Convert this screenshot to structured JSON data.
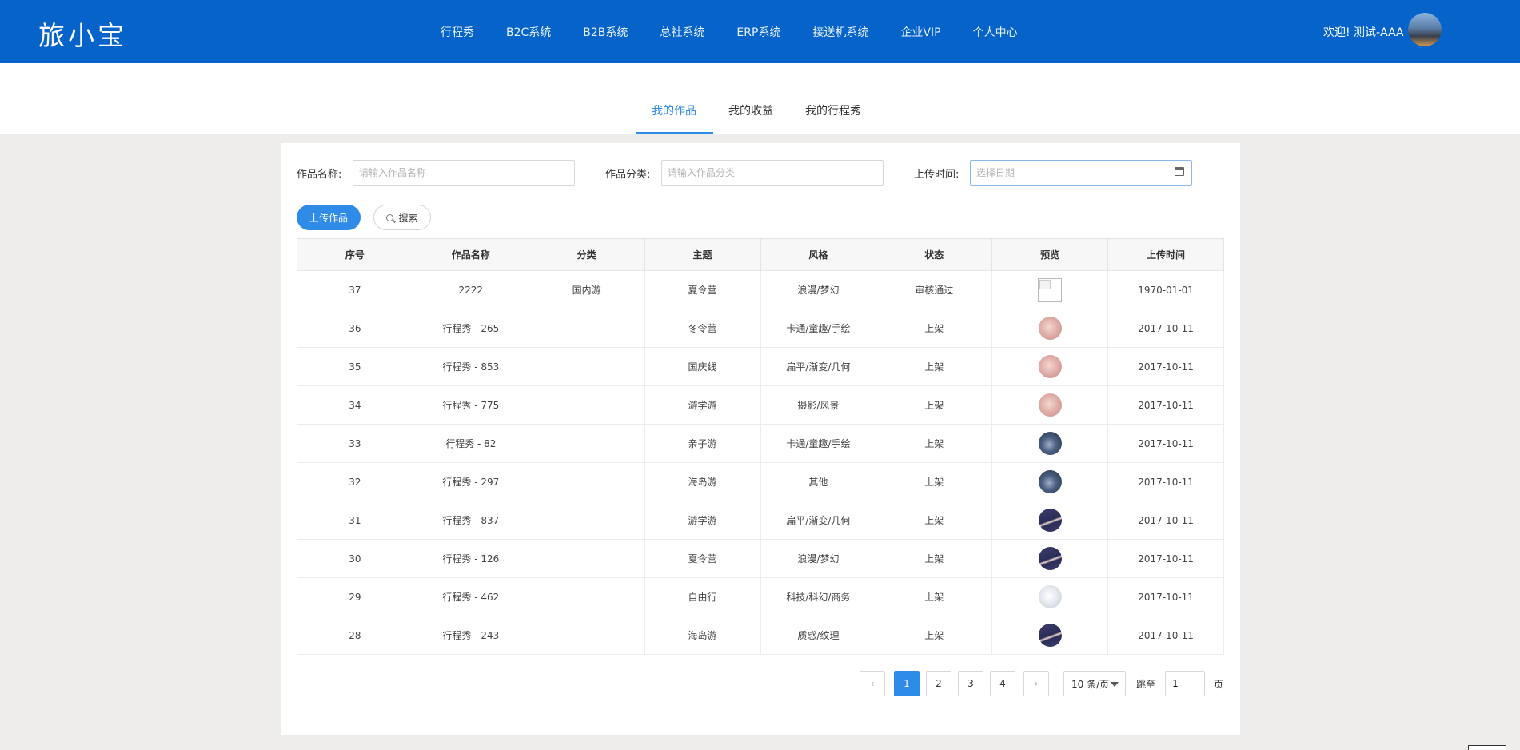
{
  "header": {
    "logo": "旅小宝",
    "nav": [
      "行程秀",
      "B2C系统",
      "B2B系统",
      "总社系统",
      "ERP系统",
      "接送机系统",
      "企业VIP",
      "个人中心"
    ],
    "welcome": "欢迎! 测试-AAA",
    "brand_color": "#0563c9"
  },
  "tabs": {
    "items": [
      "我的作品",
      "我的收益",
      "我的行程秀"
    ],
    "active": "我的作品"
  },
  "filters": {
    "name_label": "作品名称:",
    "name_placeholder": "请输入作品名称",
    "category_label": "作品分类:",
    "category_placeholder": "请输入作品分类",
    "time_label": "上传时间:",
    "time_placeholder": "选择日期",
    "upload_button": "上传作品",
    "search_button": "搜索"
  },
  "table": {
    "columns": [
      "序号",
      "作品名称",
      "分类",
      "主题",
      "风格",
      "状态",
      "预览",
      "上传时间"
    ],
    "rows": [
      {
        "id": "37",
        "name": "2222",
        "category": "国内游",
        "theme": "夏令营",
        "style": "浪漫/梦幻",
        "status": "审核通过",
        "preview": "broken",
        "date": "1970-01-01"
      },
      {
        "id": "36",
        "name": "行程秀 - 265",
        "category": "",
        "theme": "冬令营",
        "style": "卡通/童趣/手绘",
        "status": "上架",
        "preview": "pink",
        "date": "2017-10-11"
      },
      {
        "id": "35",
        "name": "行程秀 - 853",
        "category": "",
        "theme": "国庆线",
        "style": "扁平/渐变/几何",
        "status": "上架",
        "preview": "pink",
        "date": "2017-10-11"
      },
      {
        "id": "34",
        "name": "行程秀 - 775",
        "category": "",
        "theme": "游学游",
        "style": "摄影/风景",
        "status": "上架",
        "preview": "pink",
        "date": "2017-10-11"
      },
      {
        "id": "33",
        "name": "行程秀 - 82",
        "category": "",
        "theme": "亲子游",
        "style": "卡通/童趣/手绘",
        "status": "上架",
        "preview": "navy",
        "date": "2017-10-11"
      },
      {
        "id": "32",
        "name": "行程秀 - 297",
        "category": "",
        "theme": "海岛游",
        "style": "其他",
        "status": "上架",
        "preview": "navy",
        "date": "2017-10-11"
      },
      {
        "id": "31",
        "name": "行程秀 - 837",
        "category": "",
        "theme": "游学游",
        "style": "扁平/渐变/几何",
        "status": "上架",
        "preview": "dusk",
        "date": "2017-10-11"
      },
      {
        "id": "30",
        "name": "行程秀 - 126",
        "category": "",
        "theme": "夏令营",
        "style": "浪漫/梦幻",
        "status": "上架",
        "preview": "dusk",
        "date": "2017-10-11"
      },
      {
        "id": "29",
        "name": "行程秀 - 462",
        "category": "",
        "theme": "自由行",
        "style": "科技/科幻/商务",
        "status": "上架",
        "preview": "pale",
        "date": "2017-10-11"
      },
      {
        "id": "28",
        "name": "行程秀 - 243",
        "category": "",
        "theme": "海岛游",
        "style": "质感/纹理",
        "status": "上架",
        "preview": "dusk",
        "date": "2017-10-11"
      }
    ]
  },
  "pagination": {
    "pages": [
      "1",
      "2",
      "3",
      "4"
    ],
    "current": "1",
    "page_size": "10 条/页",
    "jump_label": "跳至",
    "jump_value": "1",
    "page_suffix": "页"
  }
}
